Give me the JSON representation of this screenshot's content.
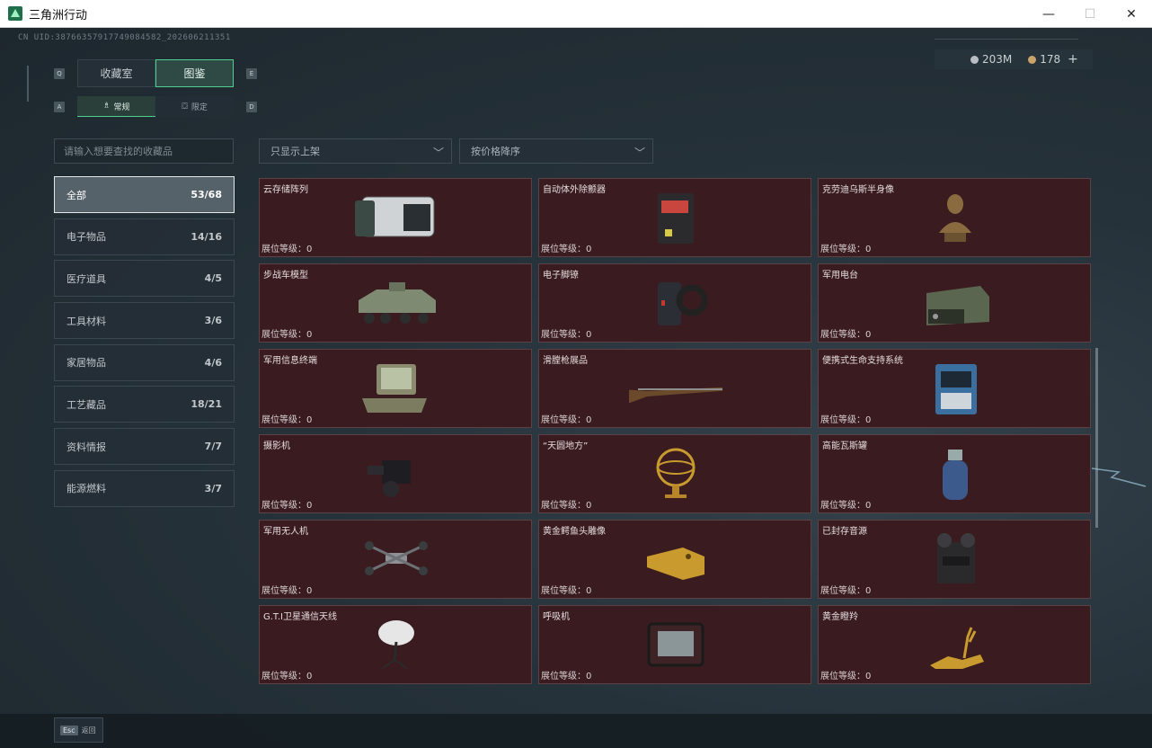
{
  "window": {
    "title": "三角洲行动",
    "minimize": "—",
    "maximize": "☐",
    "close": "✕"
  },
  "header": {
    "uid": "CN UID:38766357917749084582_202606211351",
    "currency_silver": "203M",
    "currency_gold": "178",
    "plus": "+"
  },
  "tabs": {
    "key_left": "Q",
    "key_right": "E",
    "items": [
      {
        "label": "收藏室",
        "active": false
      },
      {
        "label": "图鉴",
        "active": true
      }
    ]
  },
  "subtabs": {
    "key_left": "A",
    "key_right": "D",
    "items": [
      {
        "label": "常规",
        "icon": "♗",
        "active": true
      },
      {
        "label": "限定",
        "icon": "⛋",
        "active": false
      }
    ]
  },
  "search": {
    "placeholder": "请输入想要查找的收藏品"
  },
  "filters": {
    "shelf": "只显示上架",
    "sort": "按价格降序"
  },
  "categories": [
    {
      "label": "全部",
      "count": "53/68",
      "active": true
    },
    {
      "label": "电子物品",
      "count": "14/16"
    },
    {
      "label": "医疗道具",
      "count": "4/5"
    },
    {
      "label": "工具材料",
      "count": "3/6"
    },
    {
      "label": "家居物品",
      "count": "4/6"
    },
    {
      "label": "工艺藏品",
      "count": "18/21"
    },
    {
      "label": "资料情报",
      "count": "7/7"
    },
    {
      "label": "能源燃料",
      "count": "3/7"
    }
  ],
  "items": [
    {
      "name": "云存储阵列",
      "level": "展位等级：0",
      "icon": "server-array"
    },
    {
      "name": "自动体外除颤器",
      "level": "展位等级：0",
      "icon": "defibrillator"
    },
    {
      "name": "克劳迪乌斯半身像",
      "level": "展位等级：0",
      "icon": "bust"
    },
    {
      "name": "步战车模型",
      "level": "展位等级：0",
      "icon": "ifv-model"
    },
    {
      "name": "电子脚镣",
      "level": "展位等级：0",
      "icon": "ankle-monitor"
    },
    {
      "name": "军用电台",
      "level": "展位等级：0",
      "icon": "military-radio"
    },
    {
      "name": "军用信息终端",
      "level": "展位等级：0",
      "icon": "terminal"
    },
    {
      "name": "滑膛枪展品",
      "level": "展位等级：0",
      "icon": "musket"
    },
    {
      "name": "便携式生命支持系统",
      "level": "展位等级：0",
      "icon": "life-support"
    },
    {
      "name": "摄影机",
      "level": "展位等级：0",
      "icon": "camera"
    },
    {
      "name": "“天圆地方”",
      "level": "展位等级：0",
      "icon": "armillary-sphere"
    },
    {
      "name": "高能瓦斯罐",
      "level": "展位等级：0",
      "icon": "gas-canister"
    },
    {
      "name": "军用无人机",
      "level": "展位等级：0",
      "icon": "drone"
    },
    {
      "name": "黄金鳄鱼头雕像",
      "level": "展位等级：0",
      "icon": "golden-crocodile"
    },
    {
      "name": "已封存音源",
      "level": "展位等级：0",
      "icon": "reel-recorder"
    },
    {
      "name": "G.T.I卫星通信天线",
      "level": "展位等级：0",
      "icon": "satellite-dish"
    },
    {
      "name": "呼吸机",
      "level": "展位等级：0",
      "icon": "ventilator"
    },
    {
      "name": "黄金瞪羚",
      "level": "展位等级：0",
      "icon": "golden-gazelle"
    }
  ],
  "footer": {
    "esc_key": "Esc",
    "back_label": "返回"
  },
  "colors": {
    "accent": "#4fd08e",
    "card_bg": "#3a1c20",
    "gold": "#c9a46a"
  }
}
